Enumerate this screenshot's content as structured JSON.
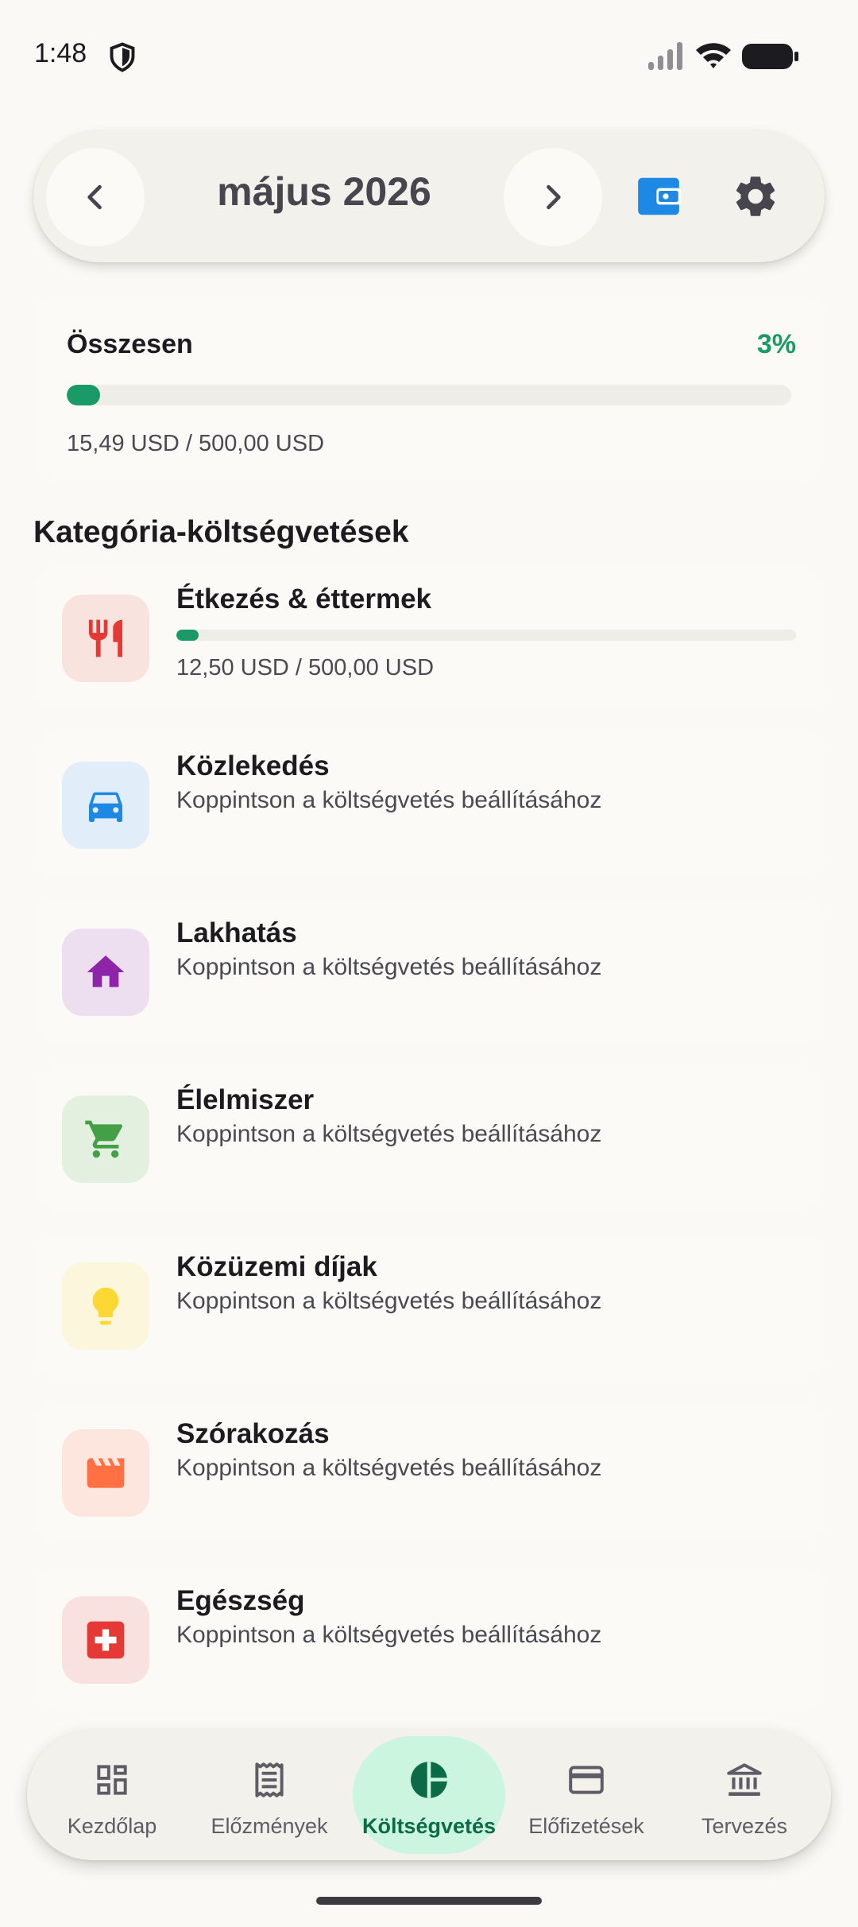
{
  "status_bar": {
    "time": "1:48"
  },
  "header": {
    "month": "május 2026"
  },
  "total": {
    "label": "Összesen",
    "percent_text": "3%",
    "progress": 0.03,
    "amount": "15,49 USD / 500,00 USD"
  },
  "section_title": "Kategória-költségvetések",
  "categories": [
    {
      "name": "Étkezés & éttermek",
      "amount": "12,50 USD / 500,00 USD",
      "progress": 0.025,
      "icon": "restaurant-icon",
      "icon_color": "#E53935",
      "bg": "#F9E3DF"
    },
    {
      "name": "Közlekedés",
      "subtitle": "Koppintson a költségvetés beállításához",
      "icon": "car-icon",
      "icon_color": "#1E88E5",
      "bg": "#E1EEF9"
    },
    {
      "name": "Lakhatás",
      "subtitle": "Koppintson a költségvetés beállításához",
      "icon": "home-icon",
      "icon_color": "#8E24AA",
      "bg": "#EEDFF0"
    },
    {
      "name": "Élelmiszer",
      "subtitle": "Koppintson a költségvetés beállításához",
      "icon": "cart-icon",
      "icon_color": "#43A047",
      "bg": "#E3F0E0"
    },
    {
      "name": "Közüzemi díjak",
      "subtitle": "Koppintson a költségvetés beállításához",
      "icon": "lightbulb-icon",
      "icon_color": "#FDD835",
      "bg": "#FCF6DC"
    },
    {
      "name": "Szórakozás",
      "subtitle": "Koppintson a költségvetés beállításához",
      "icon": "movie-icon",
      "icon_color": "#FF7043",
      "bg": "#FCE6DE"
    },
    {
      "name": "Egészség",
      "subtitle": "Koppintson a költségvetés beállításához",
      "icon": "medical-icon",
      "icon_color": "#E53935",
      "bg": "#F9E1DF"
    }
  ],
  "bottom_nav": {
    "items": [
      {
        "label": "Kezdőlap",
        "icon": "dashboard-icon"
      },
      {
        "label": "Előzmények",
        "icon": "receipt-icon"
      },
      {
        "label": "Költségvetés",
        "icon": "pie-chart-icon",
        "active": true
      },
      {
        "label": "Előfizetések",
        "icon": "credit-card-icon"
      },
      {
        "label": "Tervezés",
        "icon": "bank-icon"
      }
    ]
  },
  "colors": {
    "accent": "#1A9A66",
    "wallet": "#1E88E5",
    "active_pill": "#CCF5E0"
  }
}
